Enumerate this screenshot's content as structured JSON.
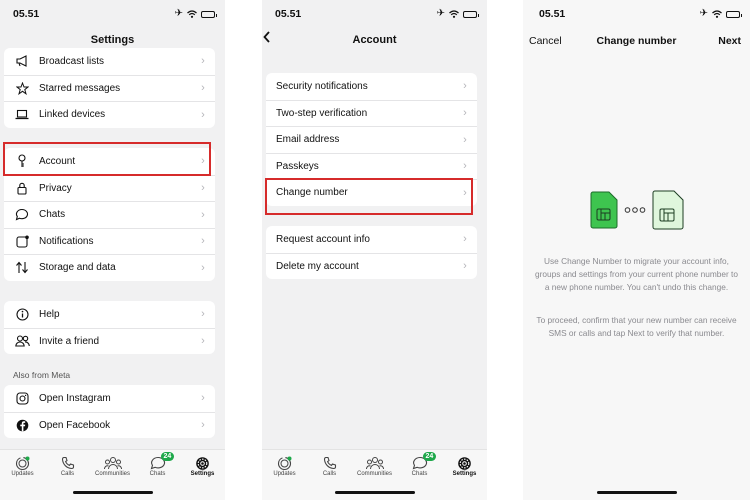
{
  "screen1": {
    "status_time": "05.51",
    "title": "Settings",
    "group1": [
      {
        "label": "Broadcast lists",
        "icon": "megaphone-icon"
      },
      {
        "label": "Starred messages",
        "icon": "star-icon"
      },
      {
        "label": "Linked devices",
        "icon": "laptop-icon"
      }
    ],
    "group2": [
      {
        "label": "Account",
        "icon": "key-icon"
      },
      {
        "label": "Privacy",
        "icon": "lock-icon"
      },
      {
        "label": "Chats",
        "icon": "chat-bubble-icon"
      },
      {
        "label": "Notifications",
        "icon": "notification-icon"
      },
      {
        "label": "Storage and data",
        "icon": "storage-arrows-icon"
      }
    ],
    "group3": [
      {
        "label": "Help",
        "icon": "info-icon"
      },
      {
        "label": "Invite a friend",
        "icon": "people-icon"
      }
    ],
    "meta_header": "Also from Meta",
    "group4": [
      {
        "label": "Open Instagram",
        "icon": "instagram-icon"
      },
      {
        "label": "Open Facebook",
        "icon": "facebook-icon"
      }
    ],
    "tabs": [
      {
        "label": "Updates",
        "icon": "updates-icon"
      },
      {
        "label": "Calls",
        "icon": "phone-icon"
      },
      {
        "label": "Communities",
        "icon": "communities-icon"
      },
      {
        "label": "Chats",
        "icon": "chats-icon",
        "badge": "24"
      },
      {
        "label": "Settings",
        "icon": "settings-icon"
      }
    ]
  },
  "screen2": {
    "status_time": "05.51",
    "title": "Account",
    "group1": [
      {
        "label": "Security notifications"
      },
      {
        "label": "Two-step verification"
      },
      {
        "label": "Email address"
      },
      {
        "label": "Passkeys"
      },
      {
        "label": "Change number"
      }
    ],
    "group2": [
      {
        "label": "Request account info"
      },
      {
        "label": "Delete my account"
      }
    ],
    "tabs": [
      {
        "label": "Updates"
      },
      {
        "label": "Calls"
      },
      {
        "label": "Communities"
      },
      {
        "label": "Chats",
        "badge": "24"
      },
      {
        "label": "Settings"
      }
    ]
  },
  "screen3": {
    "status_time": "05.51",
    "title": "Change number",
    "cancel_label": "Cancel",
    "next_label": "Next",
    "paragraph1": "Use Change Number to migrate your account info, groups and settings from your current phone number to a new phone number. You can't undo this change.",
    "paragraph2": "To proceed, confirm that your new number can receive SMS or calls and tap Next to verify that number."
  },
  "colors": {
    "highlight": "#d62b2b",
    "whatsapp_green": "#1ea84a",
    "sim_green_fill": "#3ec44f",
    "sim_light_fill": "#dff6dc"
  }
}
